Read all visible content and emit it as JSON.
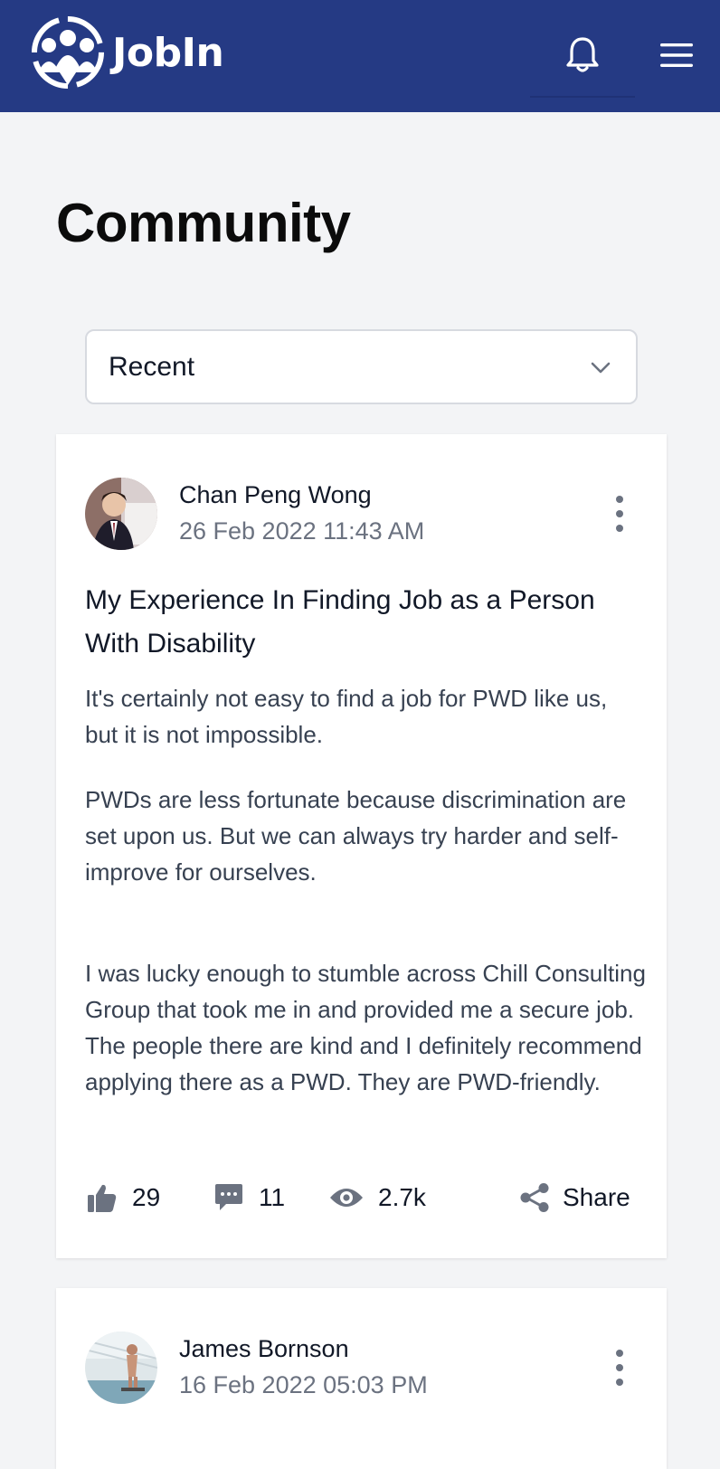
{
  "app": {
    "name": "JobIn"
  },
  "page": {
    "title": "Community"
  },
  "sort": {
    "selected": "Recent"
  },
  "posts": [
    {
      "author": "Chan Peng Wong",
      "date": "26 Feb 2022 11:43 AM",
      "title": "My Experience In Finding Job as a Person With Disability",
      "paragraphs": [
        "It's certainly not easy to find a job for PWD like us, but it is not impossible.",
        "PWDs are less fortunate because discrimination are set upon us. But we can always try harder and self-improve for ourselves.",
        "I was lucky enough to stumble across Chill Consulting Group that took me in and provided me a secure job. The people there are kind and I definitely recommend applying there as a PWD. They are PWD-friendly."
      ],
      "likes": "29",
      "comments": "11",
      "views": "2.7k",
      "share_label": "Share"
    },
    {
      "author": "James Bornson",
      "date": "16 Feb 2022 05:03 PM"
    }
  ],
  "icons": {
    "logo": "people-logo-icon",
    "bell": "bell-icon",
    "menu": "hamburger-menu-icon",
    "chevron": "chevron-down-icon",
    "kebab": "more-vertical-icon",
    "like": "thumbs-up-icon",
    "comment": "comment-icon",
    "view": "eye-icon",
    "share": "share-icon"
  },
  "colors": {
    "header": "#253a84",
    "background": "#f3f4f6",
    "icon_gray": "#6b7280"
  }
}
